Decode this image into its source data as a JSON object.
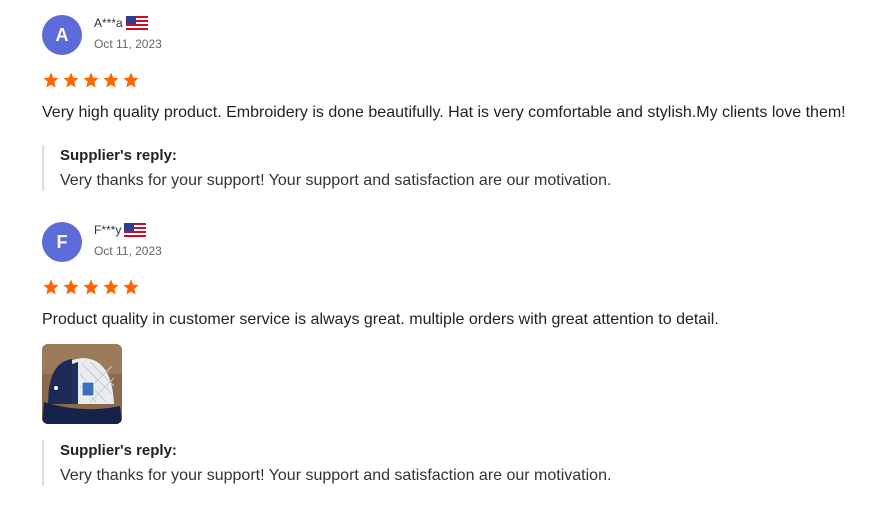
{
  "reviews": [
    {
      "avatar_letter": "A",
      "name": "A***a",
      "date": "Oct 11, 2023",
      "rating": 5,
      "text": "Very high quality product. Embroidery is done beautifully. Hat is very comfortable and stylish.My clients love them!",
      "reply_title": "Supplier's reply:",
      "reply_text": "Very thanks for your support! Your support and satisfaction are our motivation."
    },
    {
      "avatar_letter": "F",
      "name": "F***y",
      "date": "Oct 11, 2023",
      "rating": 5,
      "text": "Product quality in customer service is always great. multiple orders with great attention to detail.",
      "reply_title": "Supplier's reply:",
      "reply_text": "Very thanks for your support! Your support and satisfaction are our motivation."
    }
  ],
  "colors": {
    "avatar": "#5d6bd8",
    "star": "#ff6600"
  },
  "icons": {
    "flag": "us-flag-icon",
    "star": "star-icon",
    "photo": "review-photo-cap"
  }
}
